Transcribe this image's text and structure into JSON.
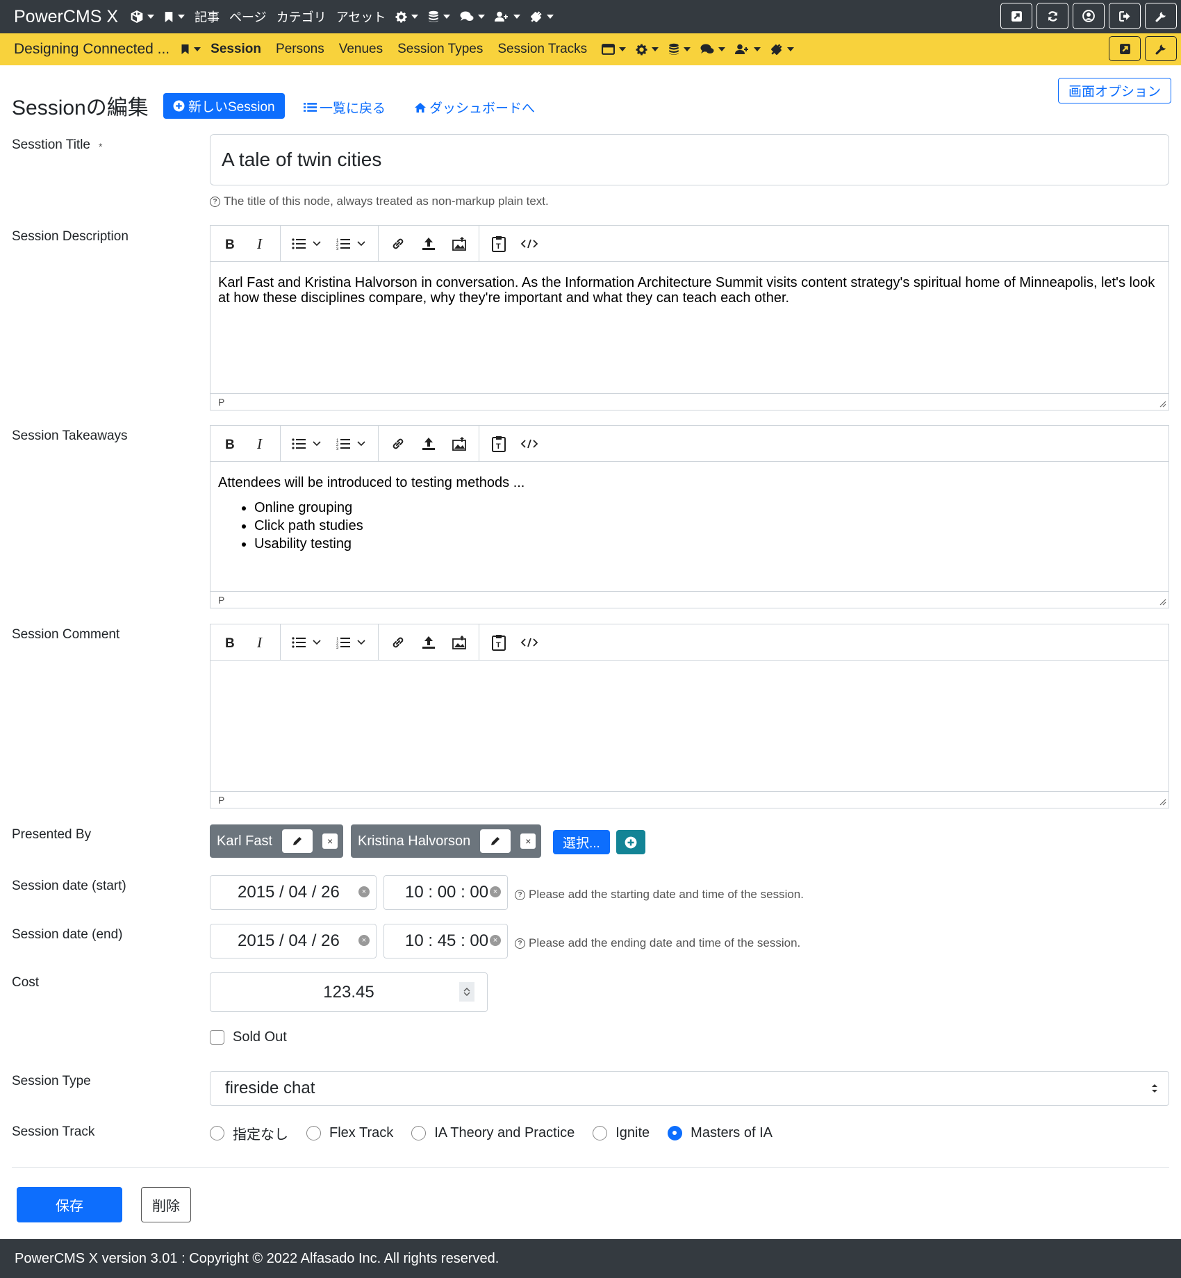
{
  "app": {
    "brand": "PowerCMS X",
    "top_nav": [
      "記事",
      "ページ",
      "カテゴリ",
      "アセット"
    ]
  },
  "workspace": {
    "name": "Designing Connected ...",
    "tabs": [
      "Session",
      "Persons",
      "Venues",
      "Session Types",
      "Session Tracks"
    ],
    "active_tab": "Session"
  },
  "header": {
    "title": "Sessionの編集",
    "new_button": "新しいSession",
    "back_link": "一覧に戻る",
    "dashboard_link": "ダッシュボードへ",
    "screen_options": "画面オプション"
  },
  "form": {
    "title_label": "Sesstion Title",
    "required_mark": "*",
    "title_value": "A tale of twin cities",
    "title_hint": "The title of this node, always treated as non-markup plain text.",
    "description_label": "Session Description",
    "description_text": "Karl Fast and Kristina Halvorson in conversation. As the Information Architecture Summit visits content strategy's spiritual home of Minneapolis, let's look at how these disciplines compare, why they're important and what they can teach each other.",
    "takeaways_label": "Session Takeaways",
    "takeaways_intro": "Attendees will be introduced to testing methods ...",
    "takeaways_items": [
      "Online grouping",
      "Click path studies",
      "Usability testing"
    ],
    "comment_label": "Session Comment",
    "editor_status": "P",
    "presented_by_label": "Presented By",
    "presenters": [
      "Karl Fast",
      "Kristina Halvorson"
    ],
    "select_button": "選択...",
    "start_label": "Session date (start)",
    "start_date": "2015 / 04 / 26",
    "start_time": "10 : 00 : 00",
    "start_hint": "Please add the starting date and time of the session.",
    "end_label": "Session date (end)",
    "end_date": "2015 / 04 / 26",
    "end_time": "10 : 45 : 00",
    "end_hint": "Please add the ending date and time of the session.",
    "cost_label": "Cost",
    "cost_value": "123.45",
    "sold_out_label": "Sold Out",
    "sold_out_checked": false,
    "type_label": "Session Type",
    "type_value": "fireside chat",
    "track_label": "Session Track",
    "track_options": [
      "指定なし",
      "Flex Track",
      "IA Theory and Practice",
      "Ignite",
      "Masters of IA"
    ],
    "track_selected": "Masters of IA",
    "save_button": "保存",
    "delete_button": "削除"
  },
  "footer": {
    "text": "PowerCMS X version 3.01 : Copyright © 2022 Alfasado Inc. All rights reserved."
  },
  "colors": {
    "topbar": "#343a40",
    "workspace_bar": "#f8d23c",
    "primary": "#0d6efd",
    "chip": "#6c757d",
    "info": "#138496"
  }
}
